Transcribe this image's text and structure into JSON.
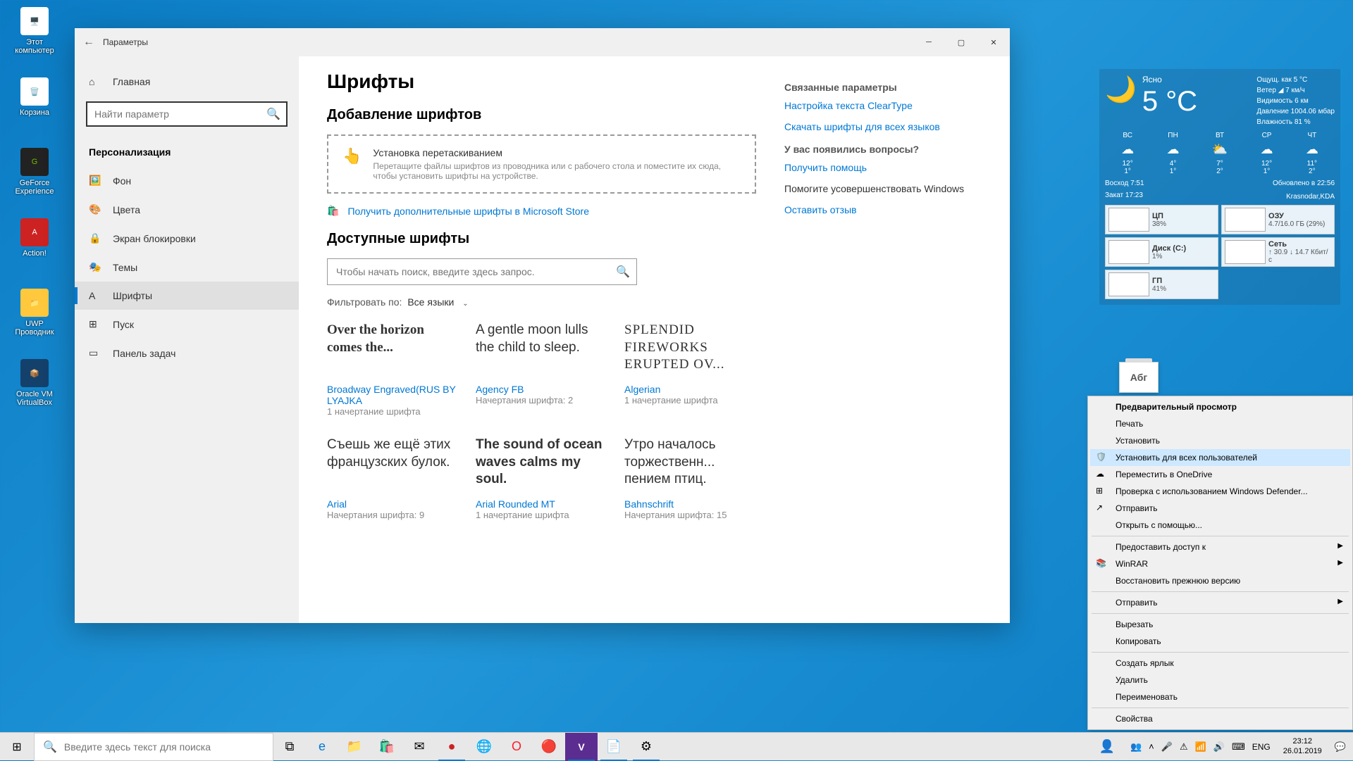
{
  "desktop": {
    "icons": [
      {
        "label": "Этот компьютер"
      },
      {
        "label": "Корзина"
      },
      {
        "label": "GeForce Experience"
      },
      {
        "label": "Action!"
      },
      {
        "label": "UWP Проводник"
      },
      {
        "label": "Oracle VM VirtualBox"
      }
    ]
  },
  "settings": {
    "title": "Параметры",
    "search_placeholder": "Найти параметр",
    "nav": {
      "home": "Главная",
      "section": "Персонализация",
      "items": [
        {
          "icon": "🖼️",
          "label": "Фон"
        },
        {
          "icon": "🎨",
          "label": "Цвета"
        },
        {
          "icon": "🔒",
          "label": "Экран блокировки"
        },
        {
          "icon": "🎭",
          "label": "Темы"
        },
        {
          "icon": "A",
          "label": "Шрифты"
        },
        {
          "icon": "⊞",
          "label": "Пуск"
        },
        {
          "icon": "▭",
          "label": "Панель задач"
        }
      ],
      "selected": 4
    },
    "page": {
      "h1": "Шрифты",
      "add_h": "Добавление шрифтов",
      "drop_title": "Установка перетаскиванием",
      "drop_sub": "Перетащите файлы шрифтов из проводника или с рабочего стола и поместите их сюда, чтобы установить шрифты на устройстве.",
      "store_link": "Получить дополнительные шрифты в Microsoft Store",
      "avail_h": "Доступные шрифты",
      "font_search_placeholder": "Чтобы начать поиск, введите здесь запрос.",
      "filter_label": "Фильтровать по:",
      "filter_value": "Все языки",
      "fonts": [
        {
          "preview": "Over the horizon comes the...",
          "name": "Broadway Engraved(RUS BY LYAJKA",
          "meta": "1 начертание шрифта",
          "style": "font-family:serif;font-weight:bold;"
        },
        {
          "preview": "A gentle moon lulls the child to sleep.",
          "name": "Agency FB",
          "meta": "Начертания шрифта: 2",
          "style": "font-family:sans-serif;font-stretch:condensed;"
        },
        {
          "preview": "SPLENDID FIREWORKS ERUPTED OV...",
          "name": "Algerian",
          "meta": "1 начертание шрифта",
          "style": "font-family:serif;letter-spacing:1px;"
        },
        {
          "preview": "Съешь же ещё этих французских булок.",
          "name": "Arial",
          "meta": "Начертания шрифта: 9",
          "style": "font-family:Arial;"
        },
        {
          "preview": "The sound of ocean waves calms my soul.",
          "name": "Arial Rounded MT",
          "meta": "1 начертание шрифта",
          "style": "font-family:Arial;font-weight:bold;"
        },
        {
          "preview": "Утро началось торжественн... пением птиц.",
          "name": "Bahnschrift",
          "meta": "Начертания шрифта: 15",
          "style": "font-family:sans-serif;font-stretch:condensed;"
        }
      ]
    },
    "side": {
      "related_h": "Связанные параметры",
      "cleartype": "Настройка текста ClearType",
      "download_all": "Скачать шрифты для всех языков",
      "questions_h": "У вас появились вопросы?",
      "help": "Получить помощь",
      "improve_h": "Помогите усовершенствовать Windows",
      "feedback": "Оставить отзыв"
    }
  },
  "weather": {
    "cond": "Ясно",
    "temp": "5 °C",
    "details": [
      "Ощущ. как 5 °C",
      "Ветер ◢ 7 км/ч",
      "Видимость 6 км",
      "Давление 1004.06 мбар",
      "Влажность 81 %"
    ],
    "days": [
      {
        "d": "ВС",
        "i": "☁",
        "hi": "12°",
        "lo": "1°"
      },
      {
        "d": "ПН",
        "i": "☁",
        "hi": "4°",
        "lo": "1°"
      },
      {
        "d": "ВТ",
        "i": "⛅",
        "hi": "7°",
        "lo": "2°"
      },
      {
        "d": "СР",
        "i": "☁",
        "hi": "12°",
        "lo": "1°"
      },
      {
        "d": "ЧТ",
        "i": "☁",
        "hi": "11°",
        "lo": "2°"
      }
    ],
    "sunrise_l": "Восход",
    "sunrise": "7:51",
    "sunset_l": "Закат",
    "sunset": "17:23",
    "updated": "Обновлено в 22:56",
    "loc": "Krasnodar,KDA",
    "stats": [
      {
        "name": "ЦП",
        "val": "38%"
      },
      {
        "name": "ОЗУ",
        "val": "4.7/16.0 ГБ (29%)"
      },
      {
        "name": "Диск (C:)",
        "val": "1%"
      },
      {
        "name": "Сеть",
        "val": "↑ 30.9 ↓ 14.7 Кбит/с"
      },
      {
        "name": "ГП",
        "val": "41%"
      }
    ]
  },
  "fontfile": {
    "text": "Абг"
  },
  "context_menu": {
    "items": [
      {
        "label": "Предварительный просмотр",
        "bold": true
      },
      {
        "label": "Печать"
      },
      {
        "label": "Установить"
      },
      {
        "label": "Установить для всех пользователей",
        "icon": "🛡️",
        "hover": true
      },
      {
        "label": "Переместить в OneDrive",
        "icon": "☁"
      },
      {
        "label": "Проверка с использованием Windows Defender...",
        "icon": "⊞"
      },
      {
        "label": "Отправить",
        "icon": "↗"
      },
      {
        "label": "Открыть с помощью..."
      },
      {
        "sep": true
      },
      {
        "label": "Предоставить доступ к",
        "arrow": true
      },
      {
        "label": "WinRAR",
        "icon": "📚",
        "arrow": true
      },
      {
        "label": "Восстановить прежнюю версию"
      },
      {
        "sep": true
      },
      {
        "label": "Отправить",
        "arrow": true
      },
      {
        "sep": true
      },
      {
        "label": "Вырезать"
      },
      {
        "label": "Копировать"
      },
      {
        "sep": true
      },
      {
        "label": "Создать ярлык"
      },
      {
        "label": "Удалить"
      },
      {
        "label": "Переименовать"
      },
      {
        "sep": true
      },
      {
        "label": "Свойства"
      }
    ]
  },
  "taskbar": {
    "search_placeholder": "Введите здесь текст для поиска",
    "lang": "ENG",
    "time": "23:12",
    "date": "26.01.2019"
  }
}
